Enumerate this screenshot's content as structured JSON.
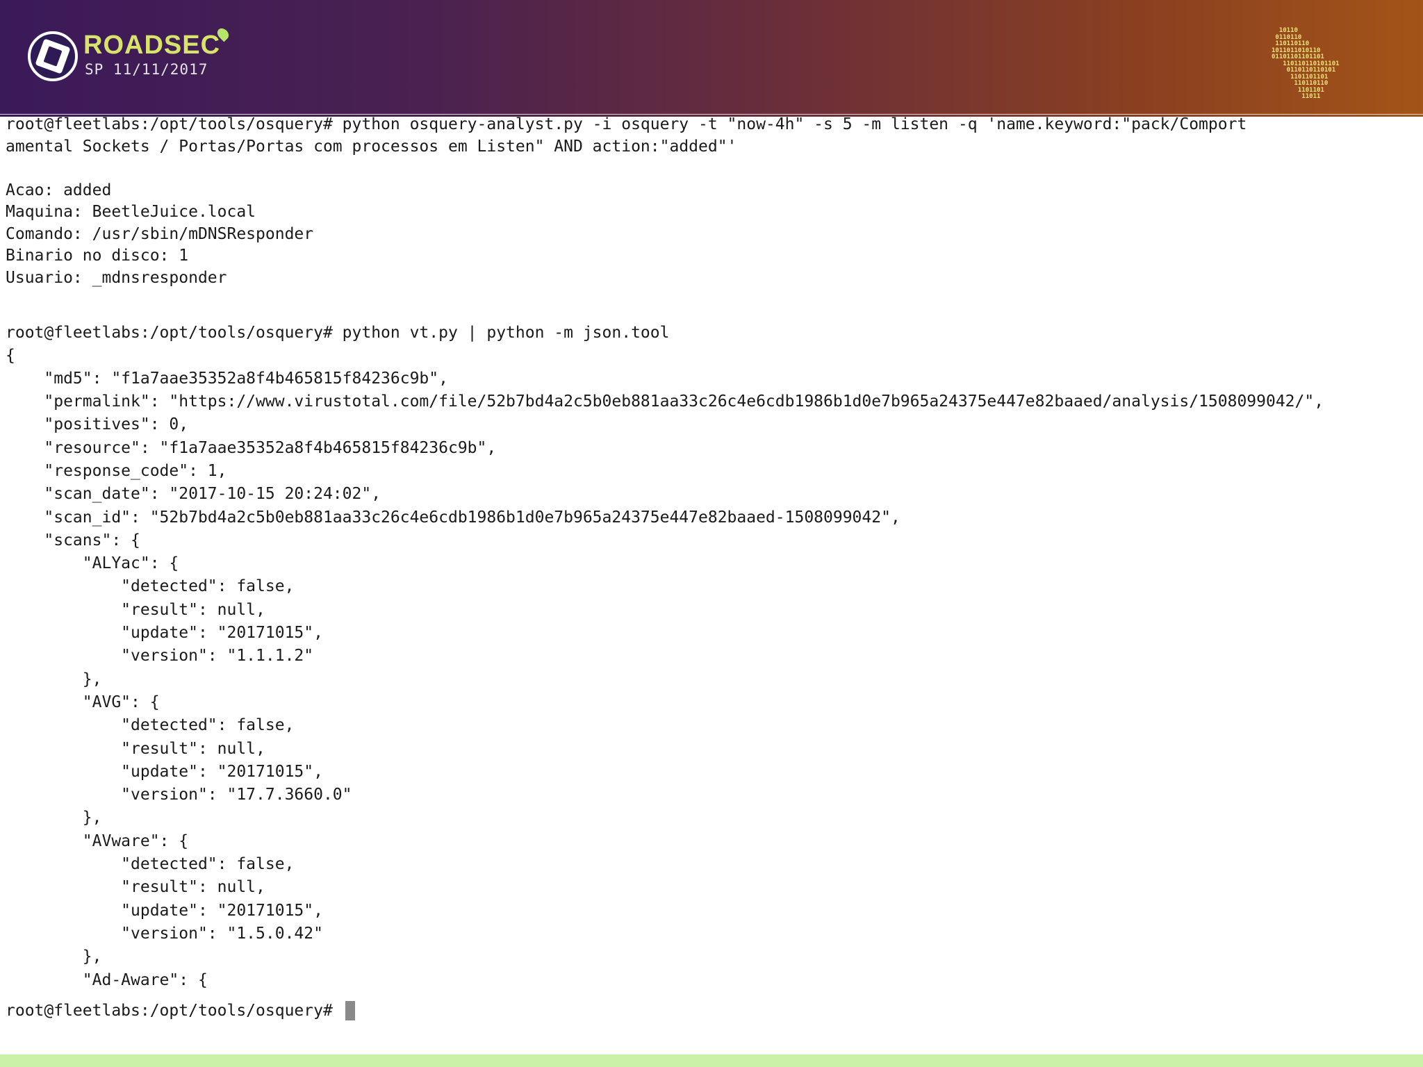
{
  "banner": {
    "brand": "ROADSEC",
    "subtitle": "SP 11/11/2017",
    "binary_art": [
      "  10110  ",
      " 0110110 ",
      " 110110110",
      "1011011010110",
      "01101101101101",
      "   110110110101101",
      "    0110110110101",
      "     1101101101",
      "      110110110",
      "       1101101",
      "        11011"
    ],
    "colors": {
      "banner_left": "#3b1a5a",
      "banner_right": "#a35418",
      "brand": "#d8e36a",
      "accent_bottom": "#c9f1a8"
    }
  },
  "terminal": {
    "cmd1": "root@fleetlabs:/opt/tools/osquery# python osquery-analyst.py -i osquery -t \"now-4h\" -s 5 -m listen -q 'name.keyword:\"pack/Comport",
    "cmd1_cont": "amental Sockets / Portas/Portas com processos em Listen\" AND action:\"added\"'",
    "result1": [
      "Acao: added",
      "Maquina: BeetleJuice.local",
      "Comando: /usr/sbin/mDNSResponder",
      "Binario no disco: 1",
      "Usuario: _mdnsresponder"
    ],
    "cmd2": "root@fleetlabs:/opt/tools/osquery# python vt.py | python -m json.tool",
    "json_lines": [
      "{",
      "    \"md5\": \"f1a7aae35352a8f4b465815f84236c9b\",",
      "    \"permalink\": \"https://www.virustotal.com/file/52b7bd4a2c5b0eb881aa33c26c4e6cdb1986b1d0e7b965a24375e447e82baaed/analysis/1508099042/\",",
      "    \"positives\": 0,",
      "    \"resource\": \"f1a7aae35352a8f4b465815f84236c9b\",",
      "    \"response_code\": 1,",
      "    \"scan_date\": \"2017-10-15 20:24:02\",",
      "    \"scan_id\": \"52b7bd4a2c5b0eb881aa33c26c4e6cdb1986b1d0e7b965a24375e447e82baaed-1508099042\",",
      "    \"scans\": {",
      "        \"ALYac\": {",
      "            \"detected\": false,",
      "            \"result\": null,",
      "            \"update\": \"20171015\",",
      "            \"version\": \"1.1.1.2\"",
      "        },",
      "        \"AVG\": {",
      "            \"detected\": false,",
      "            \"result\": null,",
      "            \"update\": \"20171015\",",
      "            \"version\": \"17.7.3660.0\"",
      "        },",
      "        \"AVware\": {",
      "            \"detected\": false,",
      "            \"result\": null,",
      "            \"update\": \"20171015\",",
      "            \"version\": \"1.5.0.42\"",
      "        },",
      "        \"Ad-Aware\": {"
    ],
    "prompt_final": "root@fleetlabs:/opt/tools/osquery#"
  }
}
